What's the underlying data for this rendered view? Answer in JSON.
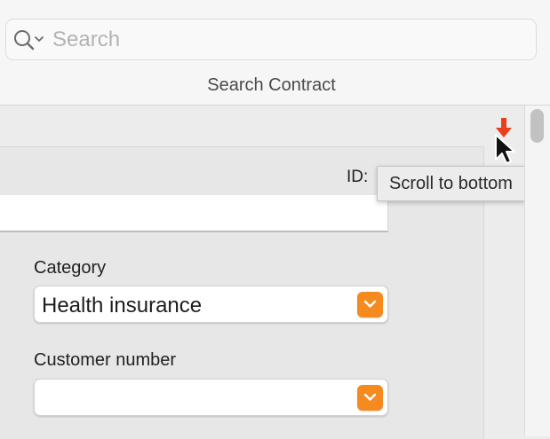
{
  "search": {
    "placeholder": "Search",
    "icon": "magnifier-with-dropdown-icon"
  },
  "toolbar": {
    "title": "Search Contract"
  },
  "record": {
    "id_label": "ID:",
    "header_value": "",
    "fields": [
      {
        "label": "Category",
        "value": "Health insurance"
      },
      {
        "label": "Customer number",
        "value": ""
      }
    ]
  },
  "scroll_to_bottom": {
    "tooltip": "Scroll to bottom",
    "icon": "red-down-arrow-icon",
    "icon_color": "#e8401c"
  },
  "colors": {
    "accent": "#f58a1f",
    "background": "#ececec"
  }
}
